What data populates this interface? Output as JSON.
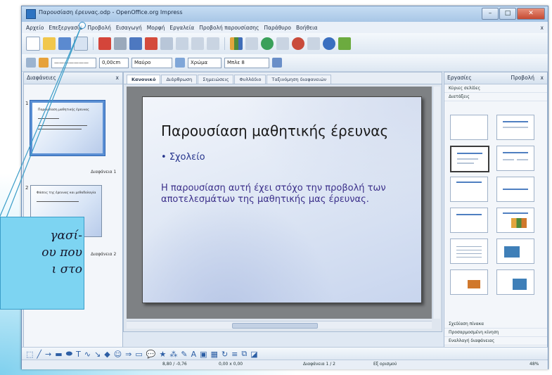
{
  "window": {
    "title": "Παρουσίαση έρευνας.odp - OpenOffice.org Impress",
    "controls": {
      "minimize": "–",
      "maximize": "□",
      "close": "✕"
    }
  },
  "menubar": {
    "items": [
      "Αρχείο",
      "Επεξεργασία",
      "Προβολή",
      "Εισαγωγή",
      "Μορφή",
      "Εργαλεία",
      "Προβολή παρουσίασης",
      "Παράθυρο",
      "Βοήθεια"
    ],
    "close": "x"
  },
  "toolbar2": {
    "line_width": "0,00cm",
    "fill_color": "Μαύρο",
    "area_style": "Χρώμα",
    "area_color": "Μπλε 8"
  },
  "slides_panel": {
    "header": "Διαφάνειες",
    "close": "x",
    "slides": [
      {
        "num": "1",
        "name": "Διαφάνεια 1",
        "thumb_title": "Παρουσίαση μαθητικής έρευνας"
      },
      {
        "num": "2",
        "name": "Διαφάνεια 2",
        "thumb_title": "Φάσεις της έρευνας και μεθοδολογία"
      }
    ]
  },
  "editor": {
    "tabs": [
      "Κανονικό",
      "Διάρθρωση",
      "Σημειώσεις",
      "Φυλλάδιο",
      "Ταξινόμηση διαφανειών"
    ],
    "slide": {
      "title": "Παρουσίαση μαθητικής έρευνας",
      "bullet": "Σχολείο",
      "body": "Η παρουσίαση αυτή έχει στόχο την προβολή των αποτελεσμάτων της μαθητικής μας έρευνας."
    }
  },
  "tasks_panel": {
    "header": "Εργασίες",
    "view_menu": "Προβολή",
    "close": "x",
    "sections": [
      "Κύριες σελίδες",
      "Διατάξεις"
    ],
    "footer_sections": [
      "Σχεδίαση πίνακα",
      "Προσαρμοσμένη κίνηση",
      "Εναλλαγή διαφάνειας"
    ]
  },
  "statusbar": {
    "position": "8,80 / -0,76",
    "size": "0,00 x 0,00",
    "slide": "Διαφάνεια 1 / 2",
    "layout": "Εξ ορισμού",
    "zoom": "48%"
  },
  "callout": {
    "text": "γασί-\nου που\nι στο"
  },
  "colors": {
    "callout_fill": "#7dd4f2",
    "slide_title": "#1a1a1a",
    "slide_text": "#3b2f8a",
    "selection": "#2f66b3"
  }
}
